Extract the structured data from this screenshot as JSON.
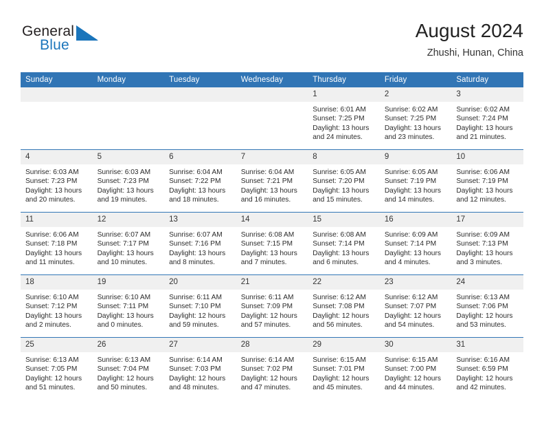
{
  "brand": {
    "name_part1": "General",
    "name_part2": "Blue",
    "flag_color": "#1b75bb"
  },
  "header": {
    "title": "August 2024",
    "subtitle": "Zhushi, Hunan, China",
    "accent_color": "#3175b5",
    "daynum_bg": "#f0f0f0"
  },
  "weekday_headers": [
    "Sunday",
    "Monday",
    "Tuesday",
    "Wednesday",
    "Thursday",
    "Friday",
    "Saturday"
  ],
  "labels": {
    "sunrise": "Sunrise:",
    "sunset": "Sunset:",
    "daylight": "Daylight:"
  },
  "weeks": [
    [
      {
        "day": "",
        "sunrise": "",
        "sunset": "",
        "daylight": "",
        "empty": true
      },
      {
        "day": "",
        "sunrise": "",
        "sunset": "",
        "daylight": "",
        "empty": true
      },
      {
        "day": "",
        "sunrise": "",
        "sunset": "",
        "daylight": "",
        "empty": true
      },
      {
        "day": "",
        "sunrise": "",
        "sunset": "",
        "daylight": "",
        "empty": true
      },
      {
        "day": "1",
        "sunrise": "Sunrise: 6:01 AM",
        "sunset": "Sunset: 7:25 PM",
        "daylight": "Daylight: 13 hours and 24 minutes."
      },
      {
        "day": "2",
        "sunrise": "Sunrise: 6:02 AM",
        "sunset": "Sunset: 7:25 PM",
        "daylight": "Daylight: 13 hours and 23 minutes."
      },
      {
        "day": "3",
        "sunrise": "Sunrise: 6:02 AM",
        "sunset": "Sunset: 7:24 PM",
        "daylight": "Daylight: 13 hours and 21 minutes."
      }
    ],
    [
      {
        "day": "4",
        "sunrise": "Sunrise: 6:03 AM",
        "sunset": "Sunset: 7:23 PM",
        "daylight": "Daylight: 13 hours and 20 minutes."
      },
      {
        "day": "5",
        "sunrise": "Sunrise: 6:03 AM",
        "sunset": "Sunset: 7:23 PM",
        "daylight": "Daylight: 13 hours and 19 minutes."
      },
      {
        "day": "6",
        "sunrise": "Sunrise: 6:04 AM",
        "sunset": "Sunset: 7:22 PM",
        "daylight": "Daylight: 13 hours and 18 minutes."
      },
      {
        "day": "7",
        "sunrise": "Sunrise: 6:04 AM",
        "sunset": "Sunset: 7:21 PM",
        "daylight": "Daylight: 13 hours and 16 minutes."
      },
      {
        "day": "8",
        "sunrise": "Sunrise: 6:05 AM",
        "sunset": "Sunset: 7:20 PM",
        "daylight": "Daylight: 13 hours and 15 minutes."
      },
      {
        "day": "9",
        "sunrise": "Sunrise: 6:05 AM",
        "sunset": "Sunset: 7:19 PM",
        "daylight": "Daylight: 13 hours and 14 minutes."
      },
      {
        "day": "10",
        "sunrise": "Sunrise: 6:06 AM",
        "sunset": "Sunset: 7:19 PM",
        "daylight": "Daylight: 13 hours and 12 minutes."
      }
    ],
    [
      {
        "day": "11",
        "sunrise": "Sunrise: 6:06 AM",
        "sunset": "Sunset: 7:18 PM",
        "daylight": "Daylight: 13 hours and 11 minutes."
      },
      {
        "day": "12",
        "sunrise": "Sunrise: 6:07 AM",
        "sunset": "Sunset: 7:17 PM",
        "daylight": "Daylight: 13 hours and 10 minutes."
      },
      {
        "day": "13",
        "sunrise": "Sunrise: 6:07 AM",
        "sunset": "Sunset: 7:16 PM",
        "daylight": "Daylight: 13 hours and 8 minutes."
      },
      {
        "day": "14",
        "sunrise": "Sunrise: 6:08 AM",
        "sunset": "Sunset: 7:15 PM",
        "daylight": "Daylight: 13 hours and 7 minutes."
      },
      {
        "day": "15",
        "sunrise": "Sunrise: 6:08 AM",
        "sunset": "Sunset: 7:14 PM",
        "daylight": "Daylight: 13 hours and 6 minutes."
      },
      {
        "day": "16",
        "sunrise": "Sunrise: 6:09 AM",
        "sunset": "Sunset: 7:14 PM",
        "daylight": "Daylight: 13 hours and 4 minutes."
      },
      {
        "day": "17",
        "sunrise": "Sunrise: 6:09 AM",
        "sunset": "Sunset: 7:13 PM",
        "daylight": "Daylight: 13 hours and 3 minutes."
      }
    ],
    [
      {
        "day": "18",
        "sunrise": "Sunrise: 6:10 AM",
        "sunset": "Sunset: 7:12 PM",
        "daylight": "Daylight: 13 hours and 2 minutes."
      },
      {
        "day": "19",
        "sunrise": "Sunrise: 6:10 AM",
        "sunset": "Sunset: 7:11 PM",
        "daylight": "Daylight: 13 hours and 0 minutes."
      },
      {
        "day": "20",
        "sunrise": "Sunrise: 6:11 AM",
        "sunset": "Sunset: 7:10 PM",
        "daylight": "Daylight: 12 hours and 59 minutes."
      },
      {
        "day": "21",
        "sunrise": "Sunrise: 6:11 AM",
        "sunset": "Sunset: 7:09 PM",
        "daylight": "Daylight: 12 hours and 57 minutes."
      },
      {
        "day": "22",
        "sunrise": "Sunrise: 6:12 AM",
        "sunset": "Sunset: 7:08 PM",
        "daylight": "Daylight: 12 hours and 56 minutes."
      },
      {
        "day": "23",
        "sunrise": "Sunrise: 6:12 AM",
        "sunset": "Sunset: 7:07 PM",
        "daylight": "Daylight: 12 hours and 54 minutes."
      },
      {
        "day": "24",
        "sunrise": "Sunrise: 6:13 AM",
        "sunset": "Sunset: 7:06 PM",
        "daylight": "Daylight: 12 hours and 53 minutes."
      }
    ],
    [
      {
        "day": "25",
        "sunrise": "Sunrise: 6:13 AM",
        "sunset": "Sunset: 7:05 PM",
        "daylight": "Daylight: 12 hours and 51 minutes."
      },
      {
        "day": "26",
        "sunrise": "Sunrise: 6:13 AM",
        "sunset": "Sunset: 7:04 PM",
        "daylight": "Daylight: 12 hours and 50 minutes."
      },
      {
        "day": "27",
        "sunrise": "Sunrise: 6:14 AM",
        "sunset": "Sunset: 7:03 PM",
        "daylight": "Daylight: 12 hours and 48 minutes."
      },
      {
        "day": "28",
        "sunrise": "Sunrise: 6:14 AM",
        "sunset": "Sunset: 7:02 PM",
        "daylight": "Daylight: 12 hours and 47 minutes."
      },
      {
        "day": "29",
        "sunrise": "Sunrise: 6:15 AM",
        "sunset": "Sunset: 7:01 PM",
        "daylight": "Daylight: 12 hours and 45 minutes."
      },
      {
        "day": "30",
        "sunrise": "Sunrise: 6:15 AM",
        "sunset": "Sunset: 7:00 PM",
        "daylight": "Daylight: 12 hours and 44 minutes."
      },
      {
        "day": "31",
        "sunrise": "Sunrise: 6:16 AM",
        "sunset": "Sunset: 6:59 PM",
        "daylight": "Daylight: 12 hours and 42 minutes."
      }
    ]
  ]
}
